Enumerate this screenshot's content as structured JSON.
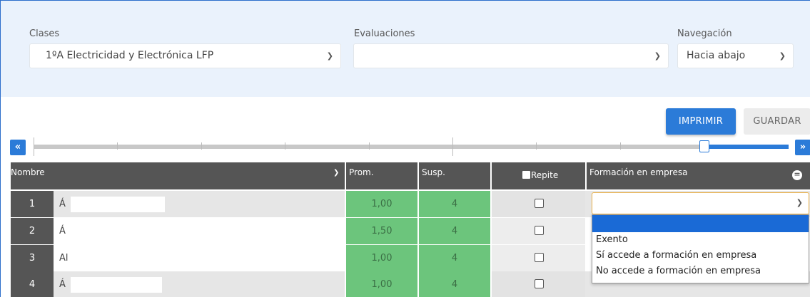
{
  "filters": {
    "clases_label": "Clases",
    "clases_value": "1ºA Electricidad y Electrónica LFP",
    "evaluaciones_label": "Evaluaciones",
    "evaluaciones_value": "",
    "navegacion_label": "Navegación",
    "navegacion_value": "Hacia abajo"
  },
  "toolbar": {
    "print_label": "IMPRIMIR",
    "save_label": "GUARDAR",
    "prev_label": "«",
    "next_label": "»"
  },
  "table": {
    "headers": {
      "nombre": "Nombre",
      "prom": "Prom.",
      "susp": "Susp.",
      "repite": "Repite",
      "formacion": "Formación en empresa"
    },
    "rows": [
      {
        "num": "1",
        "name": "Á",
        "prom": "1,00",
        "susp": "4"
      },
      {
        "num": "2",
        "name": "Á",
        "prom": "1,50",
        "susp": "4"
      },
      {
        "num": "3",
        "name": "Al",
        "prom": "1,00",
        "susp": "4"
      },
      {
        "num": "4",
        "name": "Á",
        "prom": "1,00",
        "susp": "4"
      }
    ]
  },
  "formacion_dropdown": {
    "selected": "",
    "options": [
      "",
      "Exento",
      "Sí accede a formación en empresa",
      "No accede a formación en empresa"
    ]
  },
  "colors": {
    "accent": "#2b7bd8",
    "header_bg": "#555555",
    "grade_bg": "#6cc57c",
    "filter_bg": "#eaf2fc"
  }
}
